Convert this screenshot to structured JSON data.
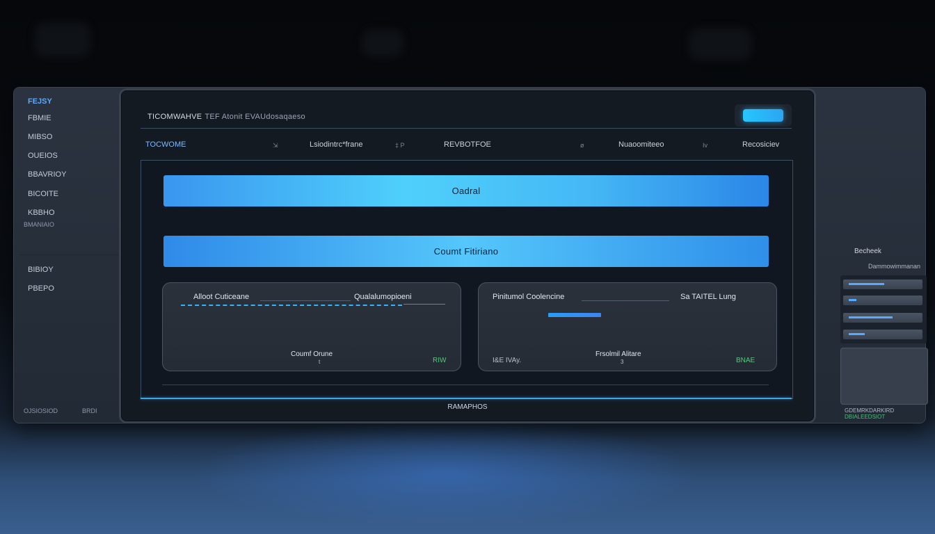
{
  "sidebar": {
    "brand": "FEJSY",
    "items": [
      "FBMIE",
      "MIBSO",
      "OUEIOS",
      "BBAVRIOY",
      "BICOITE",
      "KBBHO"
    ],
    "sub_label": "BMANIAIO",
    "items2": [
      "BIBIOY",
      "PBEPO"
    ],
    "footer_left": "OJSIOSIOD",
    "footer_right": "BRDI"
  },
  "header": {
    "title": "TICOMWAHVE",
    "subtitle": "TEF Atonit EVAUdosaqaeso",
    "button_label": ""
  },
  "nav": {
    "items": [
      "TOCWOME",
      "Lsiodintrc*frane",
      "REVBOTFOE",
      "Nuaoomiteeo",
      "Recosiciev"
    ],
    "separators": [
      "",
      "‡ P",
      "ø",
      "Iv"
    ]
  },
  "main": {
    "bar1_label": "Oadral",
    "bar2_label": "Coumt Fitiriano",
    "card_left": {
      "label_left": "Alloot Cuticeane",
      "label_right": "Qualalumopioeni",
      "footer": "Coumf Orune",
      "footer_sub": "t",
      "metric": "RIW"
    },
    "card_right": {
      "label_left": "Pinitumol Coolencine",
      "label_right": "Sa TAITEL Lung",
      "bottom_left": "I&E IVAy.",
      "footer": "Frsolmil Alitare",
      "footer_sub": "3",
      "metric": "BNAE",
      "progress": 0.31
    }
  },
  "footer": {
    "label": "RAMAPHOS"
  },
  "right_panel": {
    "title": "Becheek",
    "subtitle": "Dammowimmanan",
    "rows": [
      {
        "fill": 0.45
      },
      {
        "fill": 0.1
      },
      {
        "fill": 0.55
      },
      {
        "fill": 0.2
      }
    ],
    "footer_text": "GDEMRKDARKIRD",
    "footer_text2": "DBIALEEDSIOT"
  }
}
